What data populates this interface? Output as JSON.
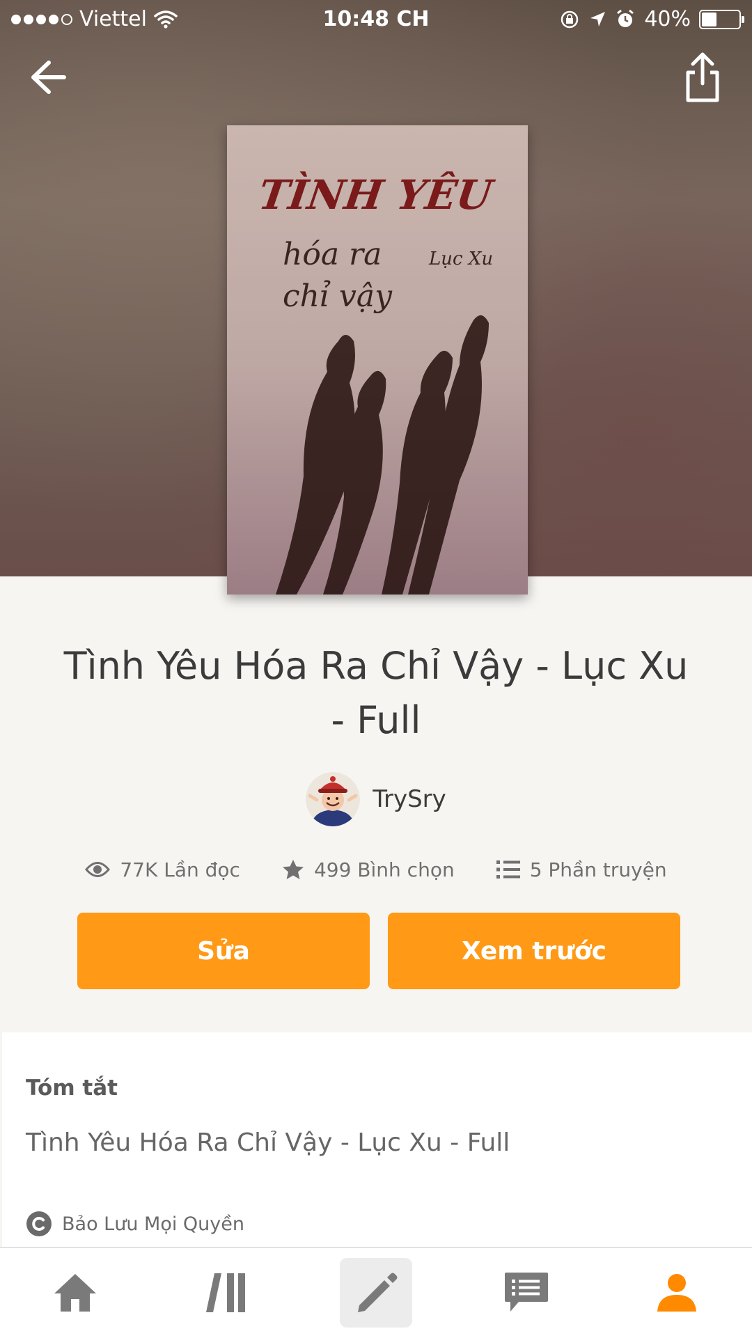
{
  "status_bar": {
    "carrier": "Viettel",
    "time": "10:48 CH",
    "battery": "40%",
    "battery_level": 0.4
  },
  "header": {
    "back_icon": "arrow-left-icon",
    "share_icon": "share-icon"
  },
  "story": {
    "title": "Tình Yêu Hóa Ra Chỉ Vậy - Lục Xu - Full",
    "author": "TrySry",
    "stats": {
      "reads": "77K Lần đọc",
      "votes": "499 Bình chọn",
      "parts": "5 Phần truyện"
    }
  },
  "actions": {
    "edit_label": "Sửa",
    "preview_label": "Xem trước"
  },
  "summary": {
    "label": "Tóm tắt",
    "text": "Tình Yêu Hóa Ra Chỉ Vậy - Lục Xu - Full",
    "copyright": "Bảo Lưu Mọi Quyền"
  },
  "tab_bar": {
    "tabs": [
      "home-icon",
      "library-icon",
      "write-icon",
      "messages-icon",
      "profile-icon"
    ],
    "active_color": "#ff8a00",
    "inactive_color": "#7a7a7a"
  },
  "colors": {
    "accent": "#ff9916",
    "background": "#f7f5f2"
  }
}
